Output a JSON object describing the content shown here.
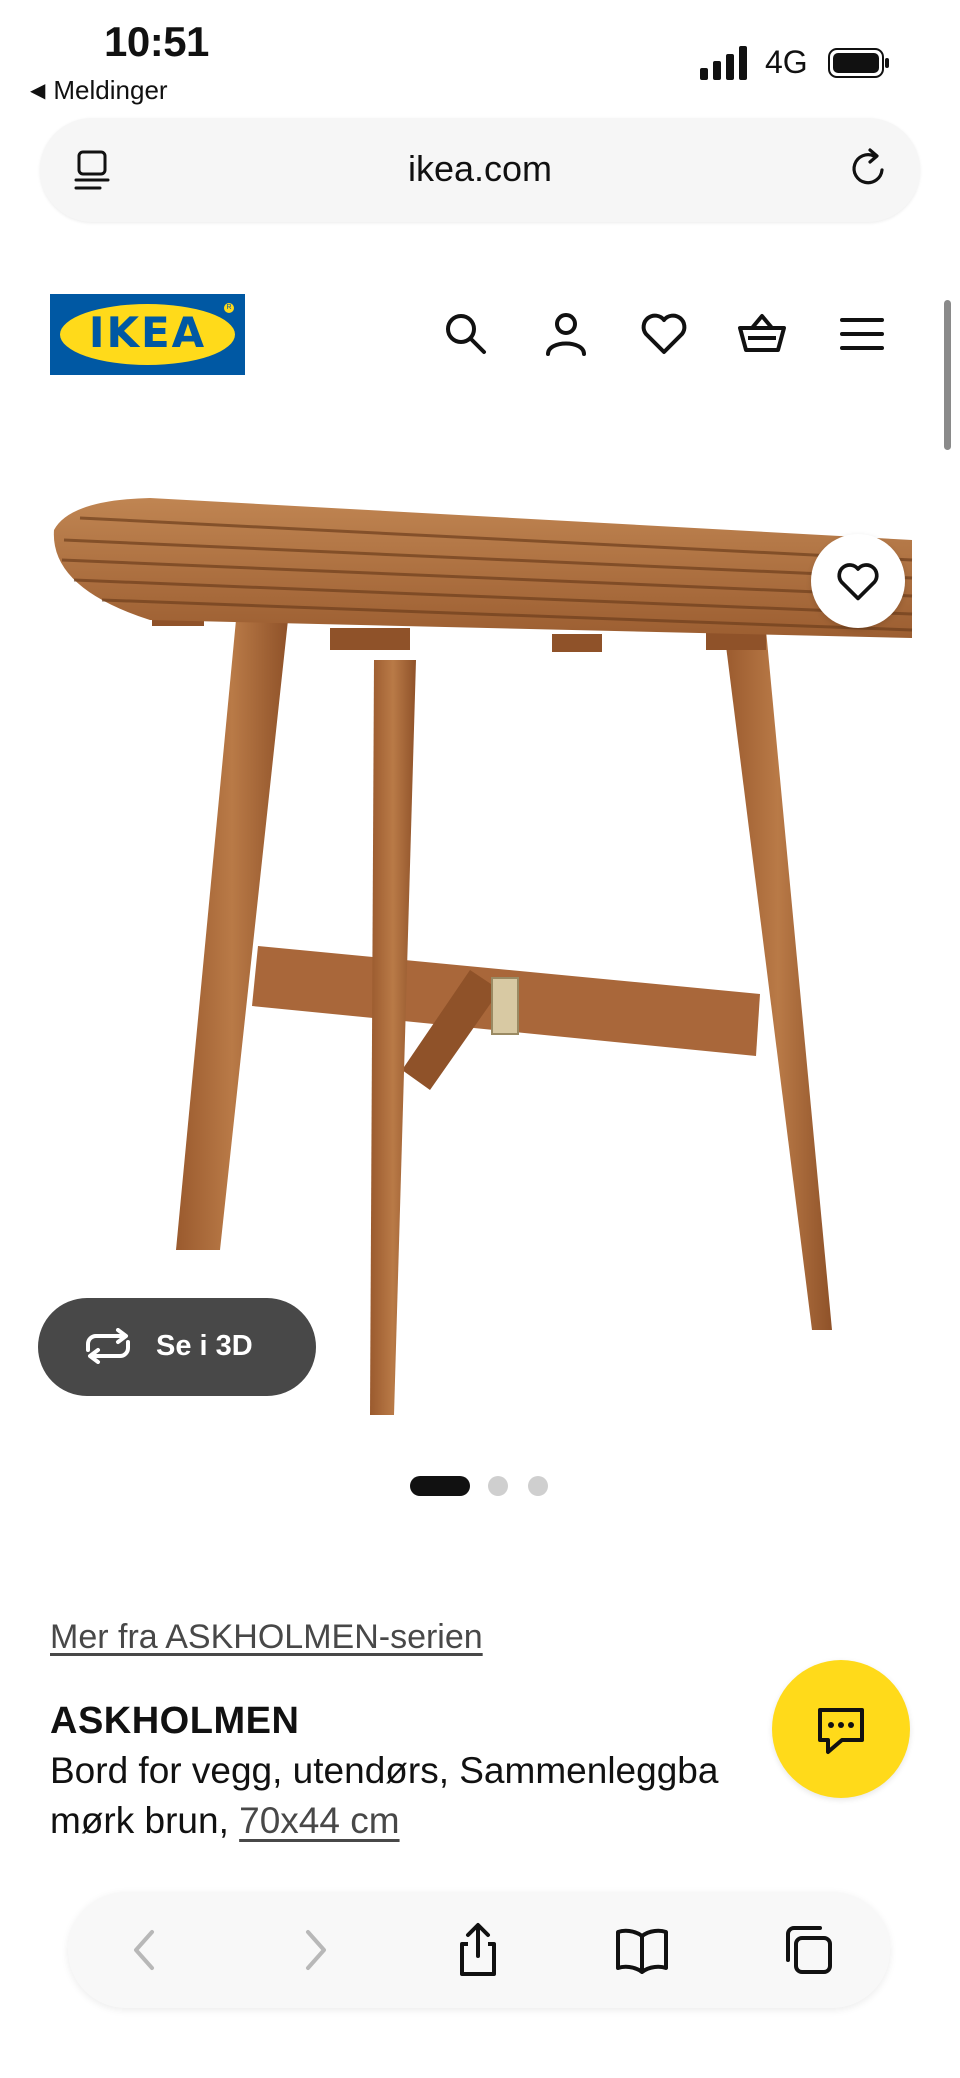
{
  "status": {
    "time": "10:51",
    "back_app": "Meldinger",
    "network": "4G"
  },
  "browser": {
    "domain": "ikea.com"
  },
  "header": {
    "logo_text": "IKEA",
    "icons": [
      "search-icon",
      "account-icon",
      "heart-icon",
      "basket-icon",
      "menu-icon"
    ]
  },
  "gallery": {
    "see3d_label": "Se i 3D",
    "total_images": 3,
    "active_index": 0
  },
  "product": {
    "series_link": "Mer fra ASKHOLMEN-serien",
    "name": "ASKHOLMEN",
    "desc_line1": "Bord for vegg, utendørs, Sammenleggba",
    "desc_line2": "mørk brun, ",
    "size": "70x44 cm"
  },
  "colors": {
    "ikea_blue": "#0058a3",
    "ikea_yellow": "#ffda1a",
    "wood": "#a8683a"
  }
}
